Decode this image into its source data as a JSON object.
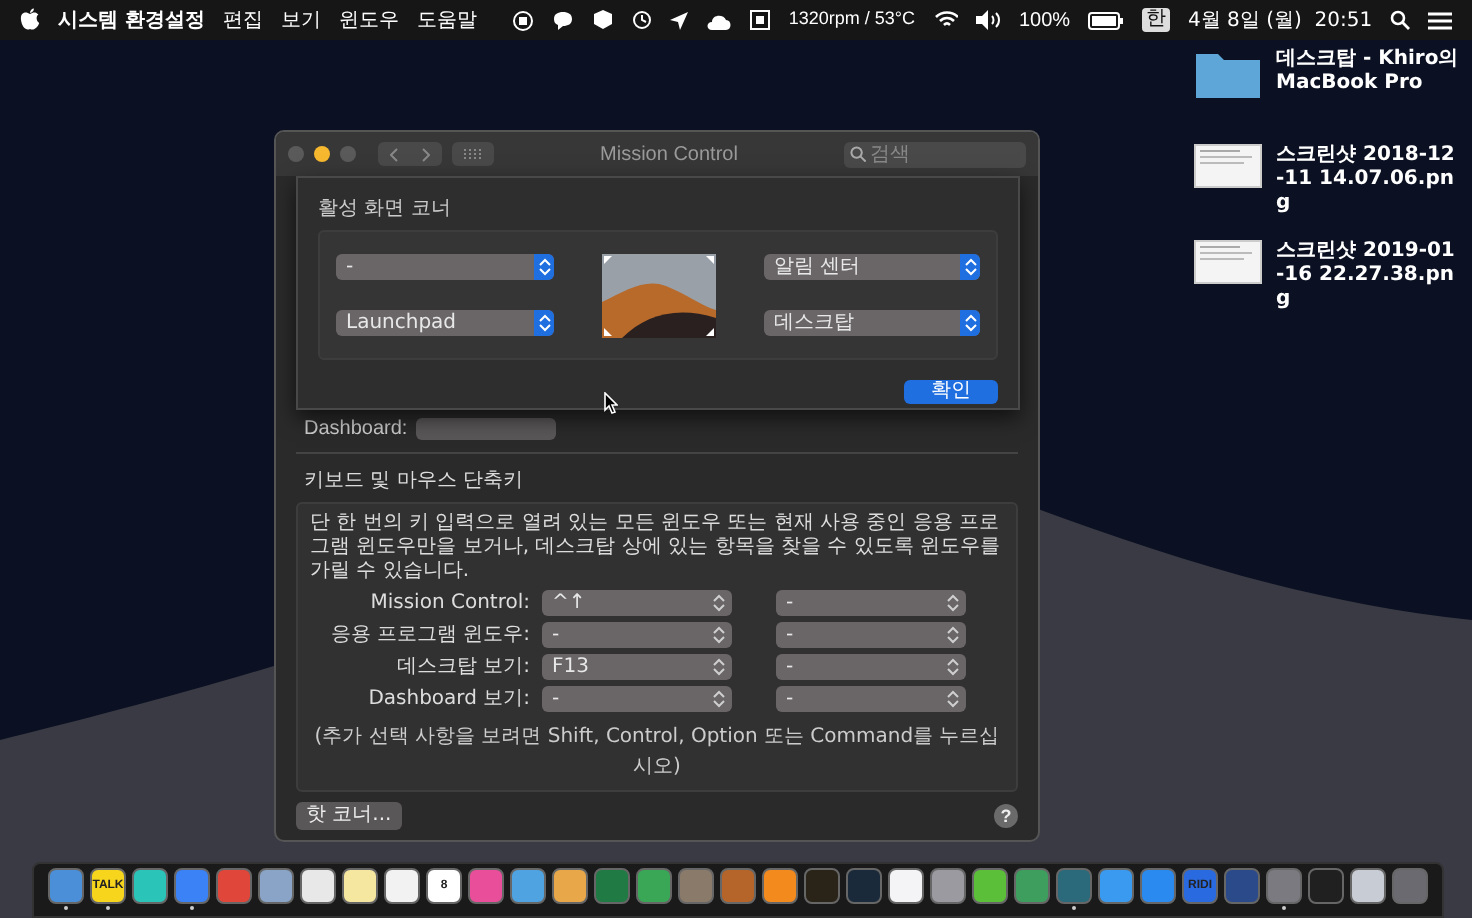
{
  "menu_bar": {
    "app_name": "시스템 환경설정",
    "menus": [
      "편집",
      "보기",
      "윈도우",
      "도움말"
    ],
    "fan_reading": "1320rpm / 53°C",
    "battery": "100%",
    "input_source": "한",
    "clock": "4월 8일 (월)  20:51"
  },
  "desktop_icons": [
    {
      "kind": "folder",
      "label": "데스크탑 - Khiro의 MacBook Pro"
    },
    {
      "kind": "screenshot",
      "label": "스크린샷 2018-12-11 14.07.06.png"
    },
    {
      "kind": "screenshot",
      "label": "스크린샷 2019-01-16 22.27.38.png"
    }
  ],
  "window": {
    "title": "Mission Control",
    "search_placeholder": "검색",
    "hot_corners_sheet": {
      "title": "활성 화면 코너",
      "corners": [
        {
          "value": "-"
        },
        {
          "value": "알림 센터"
        },
        {
          "value": "Launchpad"
        },
        {
          "value": "데스크탑"
        }
      ],
      "ok_button": "확인"
    },
    "dashboard_label": "Dashboard:",
    "shortcuts": {
      "title": "키보드 및 마우스 단축키",
      "description": "단 한 번의 키 입력으로 열려 있는 모든 윈도우 또는 현재 사용 중인 응용 프로그램 윈도우만을 보거나, 데스크탑 상에 있는 항목을 찾을 수 있도록 윈도우를 가릴 수 있습니다.",
      "rows": [
        {
          "label": "Mission Control:",
          "primary": "^↑",
          "secondary": "-"
        },
        {
          "label": "응용 프로그램 윈도우:",
          "primary": "-",
          "secondary": "-"
        },
        {
          "label": "데스크탑 보기:",
          "primary": "F13",
          "secondary": "-"
        },
        {
          "label": "Dashboard 보기:",
          "primary": "-",
          "secondary": "-"
        }
      ],
      "footnote": "(추가 선택 사항을 보려면 Shift, Control, Option 또는 Command를 누르십시오)"
    },
    "hot_corners_button": "핫 코너...",
    "help_button": "?"
  },
  "dock": [
    {
      "color": "#4a8fd8",
      "running": true
    },
    {
      "color": "#f7d51d",
      "running": true,
      "label": "TALK"
    },
    {
      "color": "#2bc4b8",
      "running": false
    },
    {
      "color": "#3b82f6",
      "running": true
    },
    {
      "color": "#e0463a",
      "running": false
    },
    {
      "color": "#8aa4c8",
      "running": false
    },
    {
      "color": "#e8e8e8",
      "running": false
    },
    {
      "color": "#f5e6a0",
      "running": false
    },
    {
      "color": "#f2f2f2",
      "running": false
    },
    {
      "color": "#ffffff",
      "running": false,
      "label": "8"
    },
    {
      "color": "#e94e9a",
      "running": false
    },
    {
      "color": "#4fa3e0",
      "running": false
    },
    {
      "color": "#e8a84a",
      "running": false
    },
    {
      "color": "#1f7a43",
      "running": false
    },
    {
      "color": "#3aa757",
      "running": false
    },
    {
      "color": "#8a7a6a",
      "running": false
    },
    {
      "color": "#b5652a",
      "running": false
    },
    {
      "color": "#f28a1e",
      "running": false
    },
    {
      "color": "#2a2418",
      "running": false
    },
    {
      "color": "#1a2a3a",
      "running": false
    },
    {
      "color": "#f4f4f6",
      "running": false
    },
    {
      "color": "#9a9aa0",
      "running": false
    },
    {
      "color": "#5cbf3a",
      "running": false
    },
    {
      "color": "#3e9e5e",
      "running": false
    },
    {
      "color": "#2a6a7a",
      "running": true
    },
    {
      "color": "#3a9af0",
      "running": false
    },
    {
      "color": "#2a8af0",
      "running": false
    },
    {
      "color": "#2a6ae0",
      "running": false,
      "label": "RIDI"
    },
    {
      "color": "#2a4a8a",
      "running": false
    },
    {
      "color": "#7a7a80",
      "running": true
    },
    {
      "color": "#202020",
      "running": false
    },
    {
      "color": "#c8ccd4",
      "running": false
    },
    {
      "color": "#6a6a70",
      "running": false
    }
  ]
}
